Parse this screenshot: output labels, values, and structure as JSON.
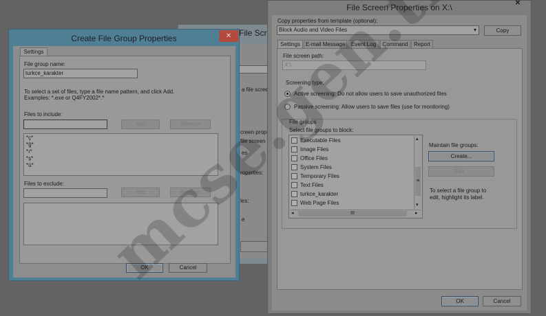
{
  "background_window": {
    "title_fragment": "File Scre",
    "fragments": [
      "a file scree",
      "creen propert",
      "file screen t",
      "es",
      "roperties:",
      "les:",
      "e"
    ]
  },
  "create_dialog": {
    "title": "Create File Group Properties",
    "close_label": "✕",
    "tab": "Settings",
    "group_name_label": "File group name:",
    "group_name_value": "turkce_karakter",
    "instructions": "To select a set of files, type a file name pattern, and click Add.",
    "examples": "Examples: *.exe or Q4FY2002*.*",
    "include_label": "Files to include:",
    "include_value": "",
    "include_items": [
      "*ç*",
      "*ğ*",
      "*ı*",
      "*ş*",
      "*ü*"
    ],
    "exclude_label": "Files to exclude:",
    "exclude_value": "",
    "add_label": "Add",
    "remove_label": "Remove",
    "ok_label": "OK",
    "cancel_label": "Cancel"
  },
  "screen_dialog": {
    "title": "File Screen Properties on X:\\",
    "close_label": "✕",
    "template_label": "Copy properties from template (optional):",
    "template_value": "Block Audio and Video Files",
    "copy_label": "Copy",
    "tabs": [
      "Settings",
      "E-mail Message",
      "Event Log",
      "Command",
      "Report"
    ],
    "path_label": "File screen path:",
    "path_value": "X:\\",
    "screening_type_label": "Screening type:",
    "active_label": "Active screening: Do not allow users to save unauthorized files",
    "passive_label": "Passive screening: Allow users to save files (use for monitoring)",
    "file_groups_label": "File groups",
    "select_groups_label": "Select file groups to block:",
    "groups": [
      "Executable Files",
      "Image Files",
      "Office Files",
      "System Files",
      "Temporary Files",
      "Text Files",
      "turkce_karakter",
      "Web Page Files"
    ],
    "scroll_thumb_glyph": "III",
    "maintain_label": "Maintain file groups:",
    "create_label": "Create...",
    "edit_label": "Edit...",
    "hint": "To select a file group to edit, highlight its label.",
    "ok_label": "OK",
    "cancel_label": "Cancel"
  },
  "watermark": "mcse.gen.tr"
}
